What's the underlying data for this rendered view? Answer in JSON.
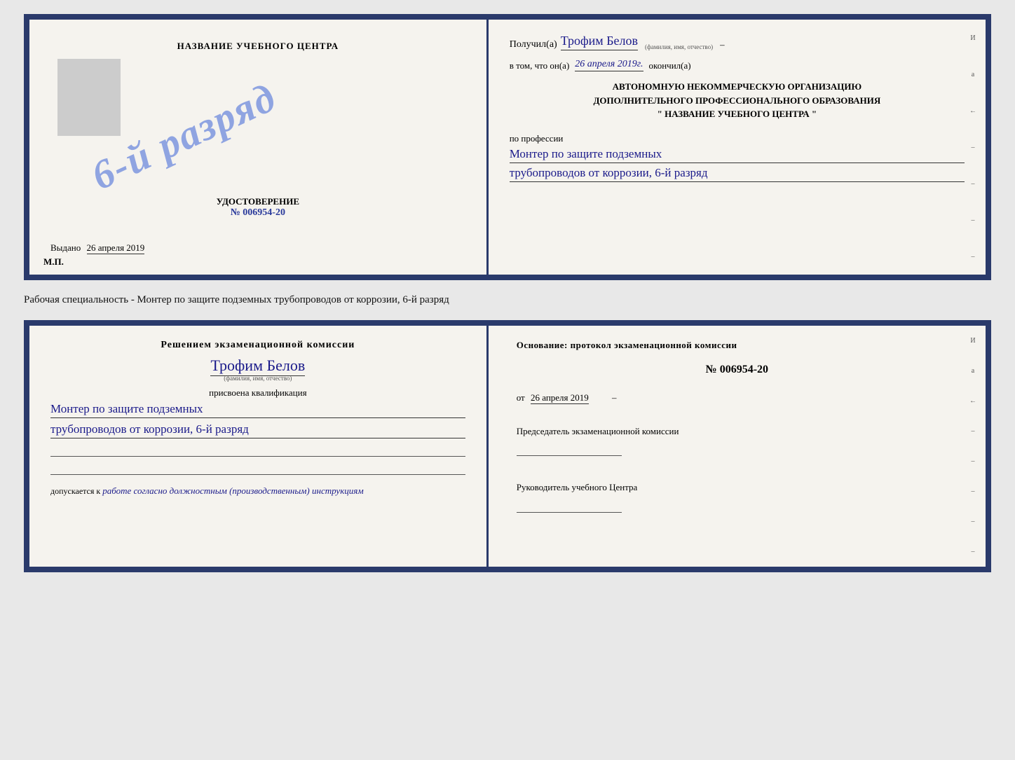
{
  "cert_top": {
    "left": {
      "title": "НАЗВАНИЕ УЧЕБНОГО ЦЕНТРА",
      "stamp_text": "6-й разряд",
      "udostoverenie_label": "УДОСТОВЕРЕНИЕ",
      "cert_number": "№ 006954-20",
      "vydano_label": "Выдано",
      "vydano_date": "26 апреля 2019",
      "mp_label": "М.П."
    },
    "right": {
      "poluchil_prefix": "Получил(а)",
      "recipient_name": "Трофим Белов",
      "fio_label": "(фамилия, имя, отчество)",
      "vtom_prefix": "в том, что он(а)",
      "completion_date": "26 апреля 2019г.",
      "okончил_suffix": "окончил(а)",
      "org_line1": "АВТОНОМНУЮ НЕКОММЕРЧЕСКУЮ ОРГАНИЗАЦИЮ",
      "org_line2": "ДОПОЛНИТЕЛЬНОГО ПРОФЕССИОНАЛЬНОГО ОБРАЗОВАНИЯ",
      "org_name": "НАЗВАНИЕ УЧЕБНОГО ЦЕНТРА",
      "po_professii": "по профессии",
      "profession_line1": "Монтер по защите подземных",
      "profession_line2": "трубопроводов от коррозии, 6-й разряд",
      "right_letters": [
        "И",
        "а",
        "←",
        "–",
        "–",
        "–",
        "–"
      ]
    }
  },
  "middle": {
    "text": "Рабочая специальность - Монтер по защите подземных трубопроводов от коррозии, 6-й разряд"
  },
  "cert_bottom": {
    "left": {
      "resheniem": "Решением экзаменационной комиссии",
      "recipient_name": "Трофим Белов",
      "fio_label": "(фамилия, имя, отчество)",
      "prisvoena": "присвоена квалификация",
      "profession_line1": "Монтер по защите подземных",
      "profession_line2": "трубопроводов от коррозии, 6-й разряд",
      "dopuskaetsya": "допускается к",
      "dopusk_text": "работе согласно должностным (производственным) инструкциям"
    },
    "right": {
      "osnovanie": "Основание: протокол экзаменационной комиссии",
      "protocol_number": "№ 006954-20",
      "ot_prefix": "от",
      "protocol_date": "26 апреля 2019",
      "predsedatel_label": "Председатель экзаменационной комиссии",
      "rukovoditel_label": "Руководитель учебного Центра",
      "right_letters": [
        "И",
        "а",
        "←",
        "–",
        "–",
        "–",
        "–",
        "–"
      ]
    }
  }
}
